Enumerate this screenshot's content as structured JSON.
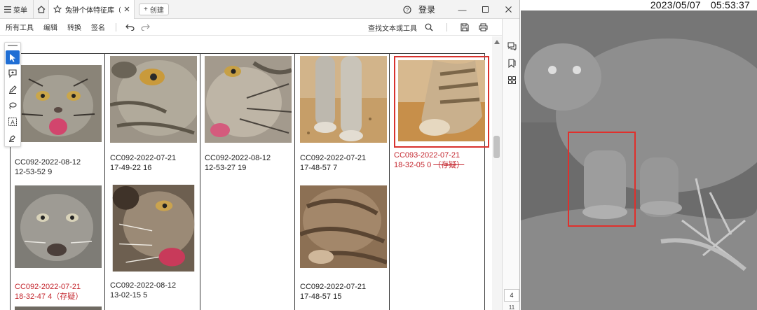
{
  "titlebar": {
    "menu_label": "菜单",
    "tab_title": "兔狲个体特征库（赛...",
    "new_tab_label": "创建",
    "login_label": "登录"
  },
  "toolbar": {
    "menu_items": [
      "所有工具",
      "编辑",
      "转换",
      "签名"
    ],
    "find_label": "查找文本或工具"
  },
  "cells": {
    "r1c1": {
      "line1": "CC092-2022-08-12",
      "line2": "12-53-52 9"
    },
    "r1c2": {
      "line1": "CC092-2022-07-21",
      "line2": "17-49-22 16"
    },
    "r1c3": {
      "line1": "CC092-2022-08-12",
      "line2": "12-53-27 19"
    },
    "r1c4": {
      "line1": "CC092-2022-07-21",
      "line2": "17-48-57 7"
    },
    "r1c5": {
      "line1": "CC093-2022-07-21",
      "line2": "18-32-05 0",
      "line2_strike": "（存疑）"
    },
    "r2c1": {
      "line1": "CC092-2022-07-21",
      "line2": "18-32-47 4（存疑）"
    },
    "r2c2": {
      "line1": "CC092-2022-08-12",
      "line2": "13-02-15 5"
    },
    "r2c4": {
      "line1": "CC092-2022-07-21",
      "line2": "17-48-57 15"
    }
  },
  "pager": {
    "current": "4",
    "total": "11"
  },
  "camera": {
    "date": "2023/05/07",
    "time": "05:53:37"
  },
  "colors": {
    "accent_blue": "#1f6ed4",
    "suspect_red": "#c4262e",
    "highlight_red": "#d8322e"
  }
}
